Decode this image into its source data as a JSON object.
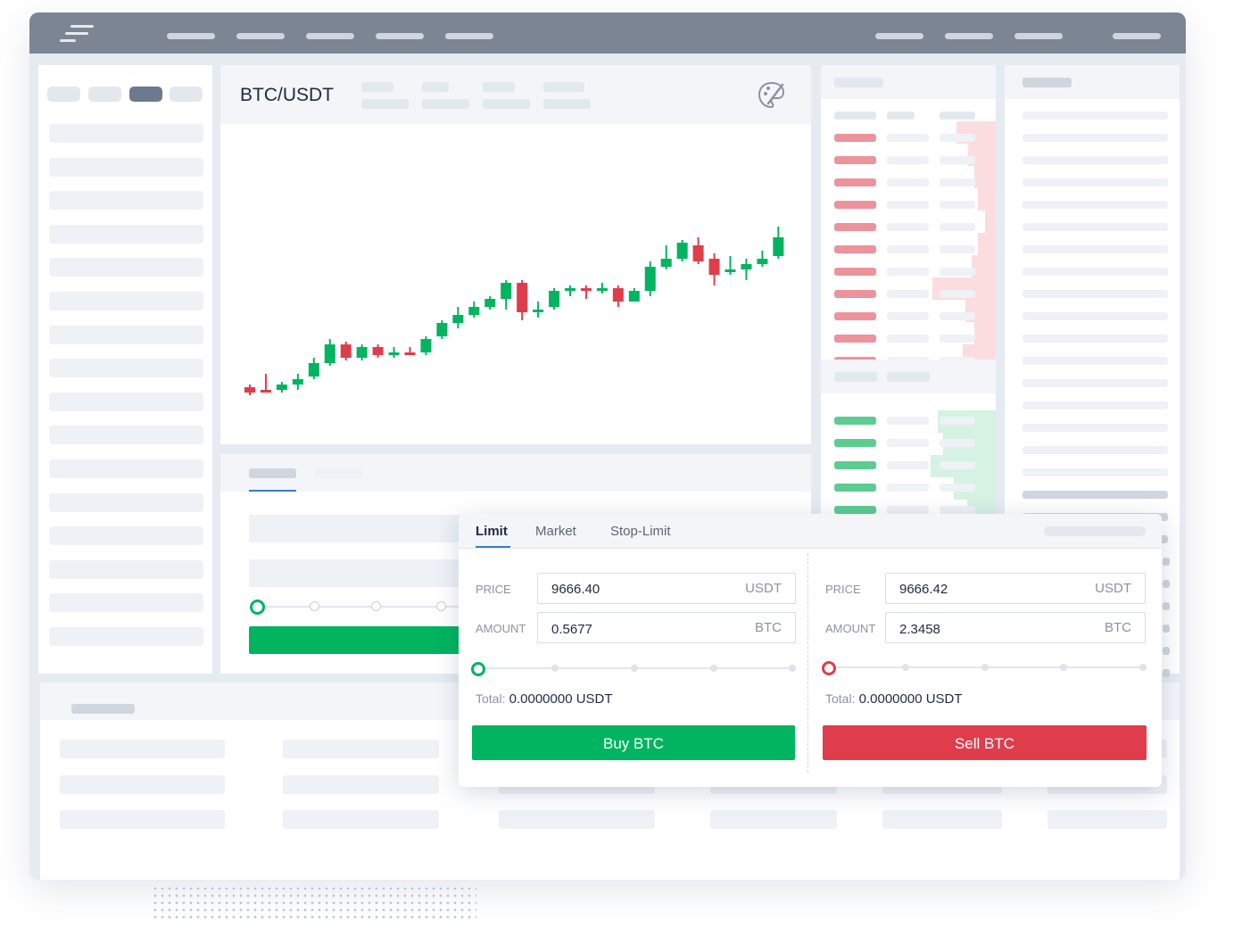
{
  "pair": {
    "title": "BTC/USDT"
  },
  "colors": {
    "buy": "#00b460",
    "sell": "#df3d4c",
    "up_candle": "#00b460",
    "down_candle": "#df3d4c"
  },
  "chart_data": {
    "type": "candlestick",
    "title": "",
    "xlabel": "",
    "ylabel": "",
    "ylim": [
      0,
      100
    ],
    "candles": [
      {
        "open": 13,
        "close": 15,
        "high": 16,
        "low": 12,
        "dir": "down"
      },
      {
        "open": 13,
        "close": 14,
        "high": 20,
        "low": 13,
        "dir": "down"
      },
      {
        "open": 14,
        "close": 16,
        "high": 17,
        "low": 13,
        "dir": "up"
      },
      {
        "open": 16,
        "close": 18,
        "high": 20,
        "low": 14,
        "dir": "up"
      },
      {
        "open": 19,
        "close": 24,
        "high": 26,
        "low": 18,
        "dir": "up"
      },
      {
        "open": 24,
        "close": 31,
        "high": 33,
        "low": 23,
        "dir": "up"
      },
      {
        "open": 31,
        "close": 26,
        "high": 32,
        "low": 25,
        "dir": "down"
      },
      {
        "open": 26,
        "close": 30,
        "high": 31,
        "low": 25,
        "dir": "up"
      },
      {
        "open": 30,
        "close": 27,
        "high": 31,
        "low": 26,
        "dir": "down"
      },
      {
        "open": 27,
        "close": 28,
        "high": 30,
        "low": 26,
        "dir": "up"
      },
      {
        "open": 28,
        "close": 28,
        "high": 30,
        "low": 27,
        "dir": "down"
      },
      {
        "open": 28,
        "close": 33,
        "high": 34,
        "low": 27,
        "dir": "up"
      },
      {
        "open": 34,
        "close": 39,
        "high": 40,
        "low": 33,
        "dir": "up"
      },
      {
        "open": 39,
        "close": 42,
        "high": 45,
        "low": 37,
        "dir": "up"
      },
      {
        "open": 42,
        "close": 45,
        "high": 47,
        "low": 41,
        "dir": "up"
      },
      {
        "open": 45,
        "close": 48,
        "high": 49,
        "low": 44,
        "dir": "up"
      },
      {
        "open": 48,
        "close": 54,
        "high": 55,
        "low": 44,
        "dir": "up"
      },
      {
        "open": 54,
        "close": 43,
        "high": 55,
        "low": 40,
        "dir": "down"
      },
      {
        "open": 43,
        "close": 44,
        "high": 47,
        "low": 41,
        "dir": "up"
      },
      {
        "open": 45,
        "close": 51,
        "high": 52,
        "low": 44,
        "dir": "up"
      },
      {
        "open": 51,
        "close": 52,
        "high": 53,
        "low": 49,
        "dir": "up"
      },
      {
        "open": 52,
        "close": 51,
        "high": 53,
        "low": 48,
        "dir": "down"
      },
      {
        "open": 51,
        "close": 52,
        "high": 54,
        "low": 50,
        "dir": "up"
      },
      {
        "open": 52,
        "close": 47,
        "high": 53,
        "low": 45,
        "dir": "down"
      },
      {
        "open": 47,
        "close": 51,
        "high": 52,
        "low": 47,
        "dir": "up"
      },
      {
        "open": 51,
        "close": 60,
        "high": 62,
        "low": 49,
        "dir": "up"
      },
      {
        "open": 60,
        "close": 63,
        "high": 68,
        "low": 59,
        "dir": "up"
      },
      {
        "open": 63,
        "close": 69,
        "high": 70,
        "low": 62,
        "dir": "up"
      },
      {
        "open": 68,
        "close": 62,
        "high": 71,
        "low": 61,
        "dir": "down"
      },
      {
        "open": 63,
        "close": 57,
        "high": 65,
        "low": 53,
        "dir": "down"
      },
      {
        "open": 58,
        "close": 59,
        "high": 64,
        "low": 57,
        "dir": "up"
      },
      {
        "open": 59,
        "close": 61,
        "high": 63,
        "low": 55,
        "dir": "up"
      },
      {
        "open": 61,
        "close": 63,
        "high": 66,
        "low": 60,
        "dir": "up"
      },
      {
        "open": 64,
        "close": 71,
        "high": 75,
        "low": 63,
        "dir": "up"
      }
    ]
  },
  "trade": {
    "tabs": [
      "Limit",
      "Market",
      "Stop-Limit"
    ],
    "buy": {
      "price_label": "PRICE",
      "price_value": "9666.40",
      "price_unit": "USDT",
      "amount_label": "AMOUNT",
      "amount_value": "0.5677",
      "amount_unit": "BTC",
      "total_label": "Total:",
      "total_value": "0.0000000",
      "total_unit": "USDT",
      "button": "Buy BTC"
    },
    "sell": {
      "price_label": "PRICE",
      "price_value": "9666.42",
      "price_unit": "USDT",
      "amount_label": "AMOUNT",
      "amount_value": "2.3458",
      "amount_unit": "BTC",
      "total_label": "Total:",
      "total_value": "0.0000000",
      "total_unit": "USDT",
      "button": "Sell BTC"
    }
  },
  "orderbook": {
    "ask_depth": [
      0.45,
      0.32,
      0.25,
      0.2,
      0.12,
      0.2,
      0.28,
      0.72,
      0.35,
      0.25,
      0.38
    ],
    "bid_depth": [
      0.55,
      0.5,
      0.62,
      0.4,
      0.27,
      1.0
    ]
  },
  "icons": {
    "theme": "palette-icon",
    "menu": "menu-icon"
  }
}
